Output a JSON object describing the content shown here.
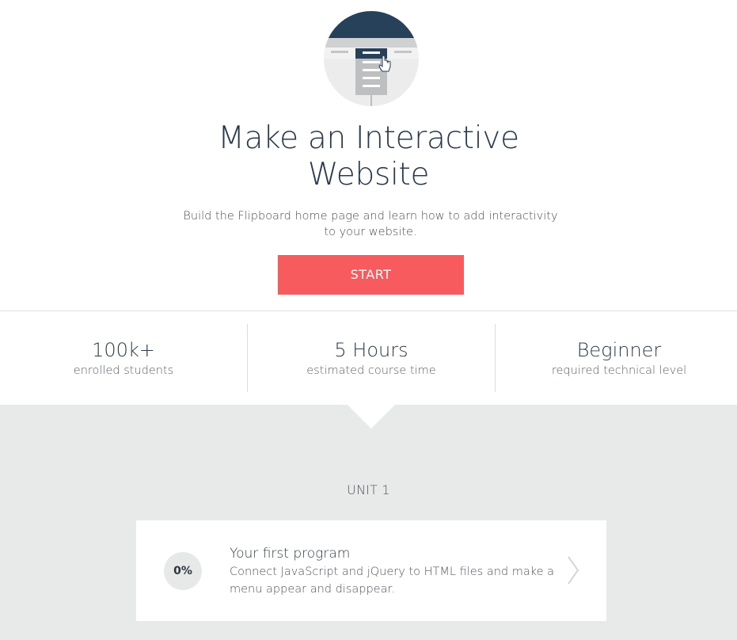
{
  "course": {
    "title_line1": "Make an Interactive",
    "title_line2": "Website",
    "description_line1": "Build the Flipboard home page and learn how to add interactivity",
    "description_line2": "to your website.",
    "start_label": "START",
    "illustration": "website-menu-cursor-illustration"
  },
  "stats": [
    {
      "value": "100k+",
      "label": "enrolled students"
    },
    {
      "value": "5 Hours",
      "label": "estimated course time"
    },
    {
      "value": "Beginner",
      "label": "required technical level"
    }
  ],
  "units": [
    {
      "heading": "UNIT 1",
      "lessons": [
        {
          "progress": "0%",
          "title": "Your first program",
          "description_line1": "Connect JavaScript and jQuery to HTML files and make a",
          "description_line2": "menu appear and disappear.",
          "icon": "chevron-right-icon"
        }
      ]
    }
  ],
  "colors": {
    "accent": "#f75b5e",
    "navy": "#264159",
    "section_bg": "#e8e9e9",
    "text_dark": "#28394d"
  }
}
